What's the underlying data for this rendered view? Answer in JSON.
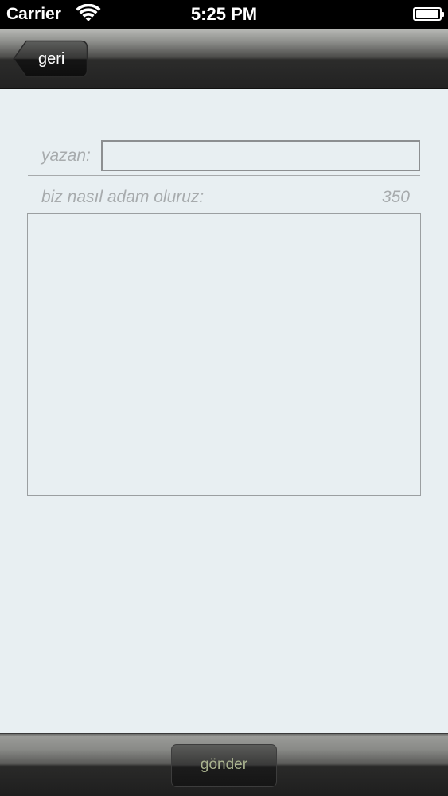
{
  "status_bar": {
    "carrier": "Carrier",
    "time": "5:25 PM",
    "wifi_icon": "wifi-icon",
    "battery_icon": "battery-icon"
  },
  "nav_bar": {
    "back_label": "geri",
    "back_icon": "back-arrow-icon"
  },
  "form": {
    "author_label": "yazan:",
    "author_value": "",
    "question_label": "biz nasıl adam oluruz:",
    "remaining_chars": "350",
    "answer_value": ""
  },
  "toolbar": {
    "send_label": "gönder"
  }
}
